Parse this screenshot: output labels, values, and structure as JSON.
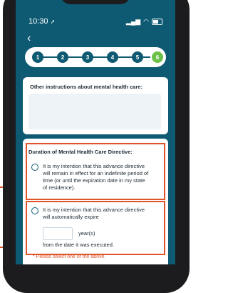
{
  "status_bar": {
    "time": "10:30",
    "location_glyph": "➚",
    "signal_glyph": "▂▄▆",
    "wifi_glyph": "◠"
  },
  "nav": {
    "back_glyph": "‹"
  },
  "stepper": {
    "steps": [
      "1",
      "2",
      "3",
      "4",
      "5",
      "6"
    ],
    "current_step": "6"
  },
  "instructions": {
    "label": "Other instructions about mental health care:",
    "value": ""
  },
  "duration": {
    "title": "Duration of Mental Health Care Directive:",
    "option1_line1": "It is my intention that this advance directive",
    "option1_line2": "will remain in effect for an indefinite period of",
    "option1_line3": "time (or until the expiration date in my state",
    "option1_line4": "of residence).",
    "option2_line1": "It is my intention that this advance directive",
    "option2_line2": "will automatically expire",
    "years_value": "",
    "years_label": "year(s)",
    "from_text": "from the date it was executed.",
    "error_text": "* Please select one of the above."
  },
  "colors": {
    "primary": "#0e5a73",
    "accent_green": "#6cc04a",
    "highlight": "#e0542a"
  }
}
